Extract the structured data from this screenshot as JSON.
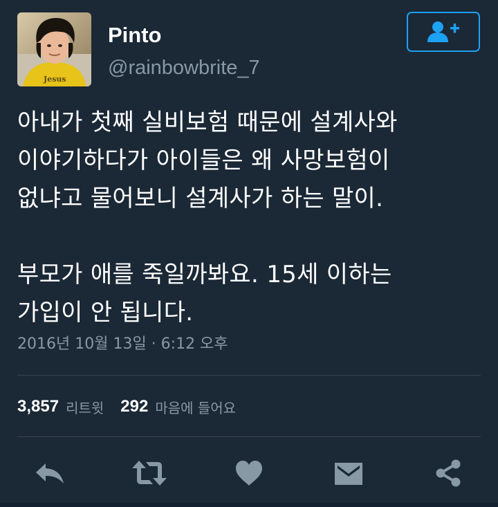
{
  "user": {
    "display_name": "Pinto",
    "handle": "@rainbowbrite_7"
  },
  "tweet": {
    "text": "아내가 첫째 실비보험 때문에 설계사와\n이야기하다가 아이들은 왜 사망보험이\n없냐고 물어보니 설계사가 하는 말이.\n\n부모가 애를 죽일까봐요. 15세 이하는\n가입이 안 됩니다.",
    "timestamp": "2016년 10월 13일 · 6:12 오후"
  },
  "stats": {
    "retweets_count": "3,857",
    "retweets_label": "리트윗",
    "likes_count": "292",
    "likes_label": "마음에 들어요"
  },
  "icons": {
    "follow": "add-user-icon",
    "reply": "reply-icon",
    "retweet": "retweet-icon",
    "like": "heart-icon",
    "message": "envelope-icon",
    "share": "share-icon"
  },
  "colors": {
    "background": "#1b2836",
    "accent": "#1da1f2",
    "secondary_text": "#8899a6",
    "action_icon": "#8899a6",
    "divider": "#38444d"
  }
}
